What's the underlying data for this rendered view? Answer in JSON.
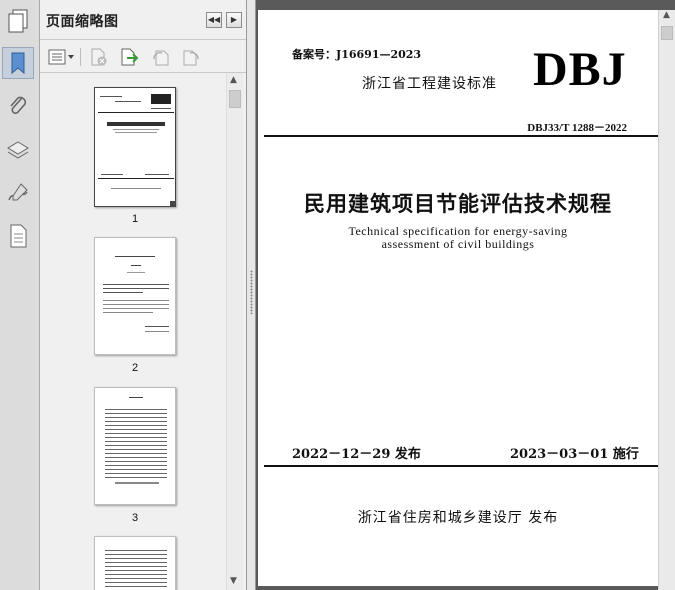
{
  "navigation_rail": {
    "icons": [
      "pages-icon",
      "bookmark-icon",
      "attachment-icon",
      "layers-icon",
      "signature-icon",
      "document-icon"
    ]
  },
  "thumbnail_panel": {
    "title": "页面缩略图",
    "collapse_glyph": "◀◀",
    "expand_glyph": "▶",
    "thumbnails": [
      {
        "page_number": "1"
      },
      {
        "page_number": "2"
      },
      {
        "page_number": "3"
      },
      {
        "page_number": ""
      }
    ]
  },
  "document": {
    "filing_number": "备案号：J16691—2023",
    "standard_type": "浙江省工程建设标准",
    "logo": "DBJ",
    "standard_code": "DBJ33/T 1288－2022",
    "title_cn": "民用建筑项目节能评估技术规程",
    "title_en_line1": "Technical specification for energy-saving",
    "title_en_line2": "assessment of civil buildings",
    "issue_date": "2022－12－29 发布",
    "effective_date": "2023－03－01 施行",
    "publisher": "浙江省住房和城乡建设厅   发布"
  },
  "colors": {
    "rail_bg": "#dcdcdc",
    "panel_bg": "#f0f0f0",
    "workspace_bg": "#5a5a5a",
    "accent_icon": "#3f7fbf"
  }
}
